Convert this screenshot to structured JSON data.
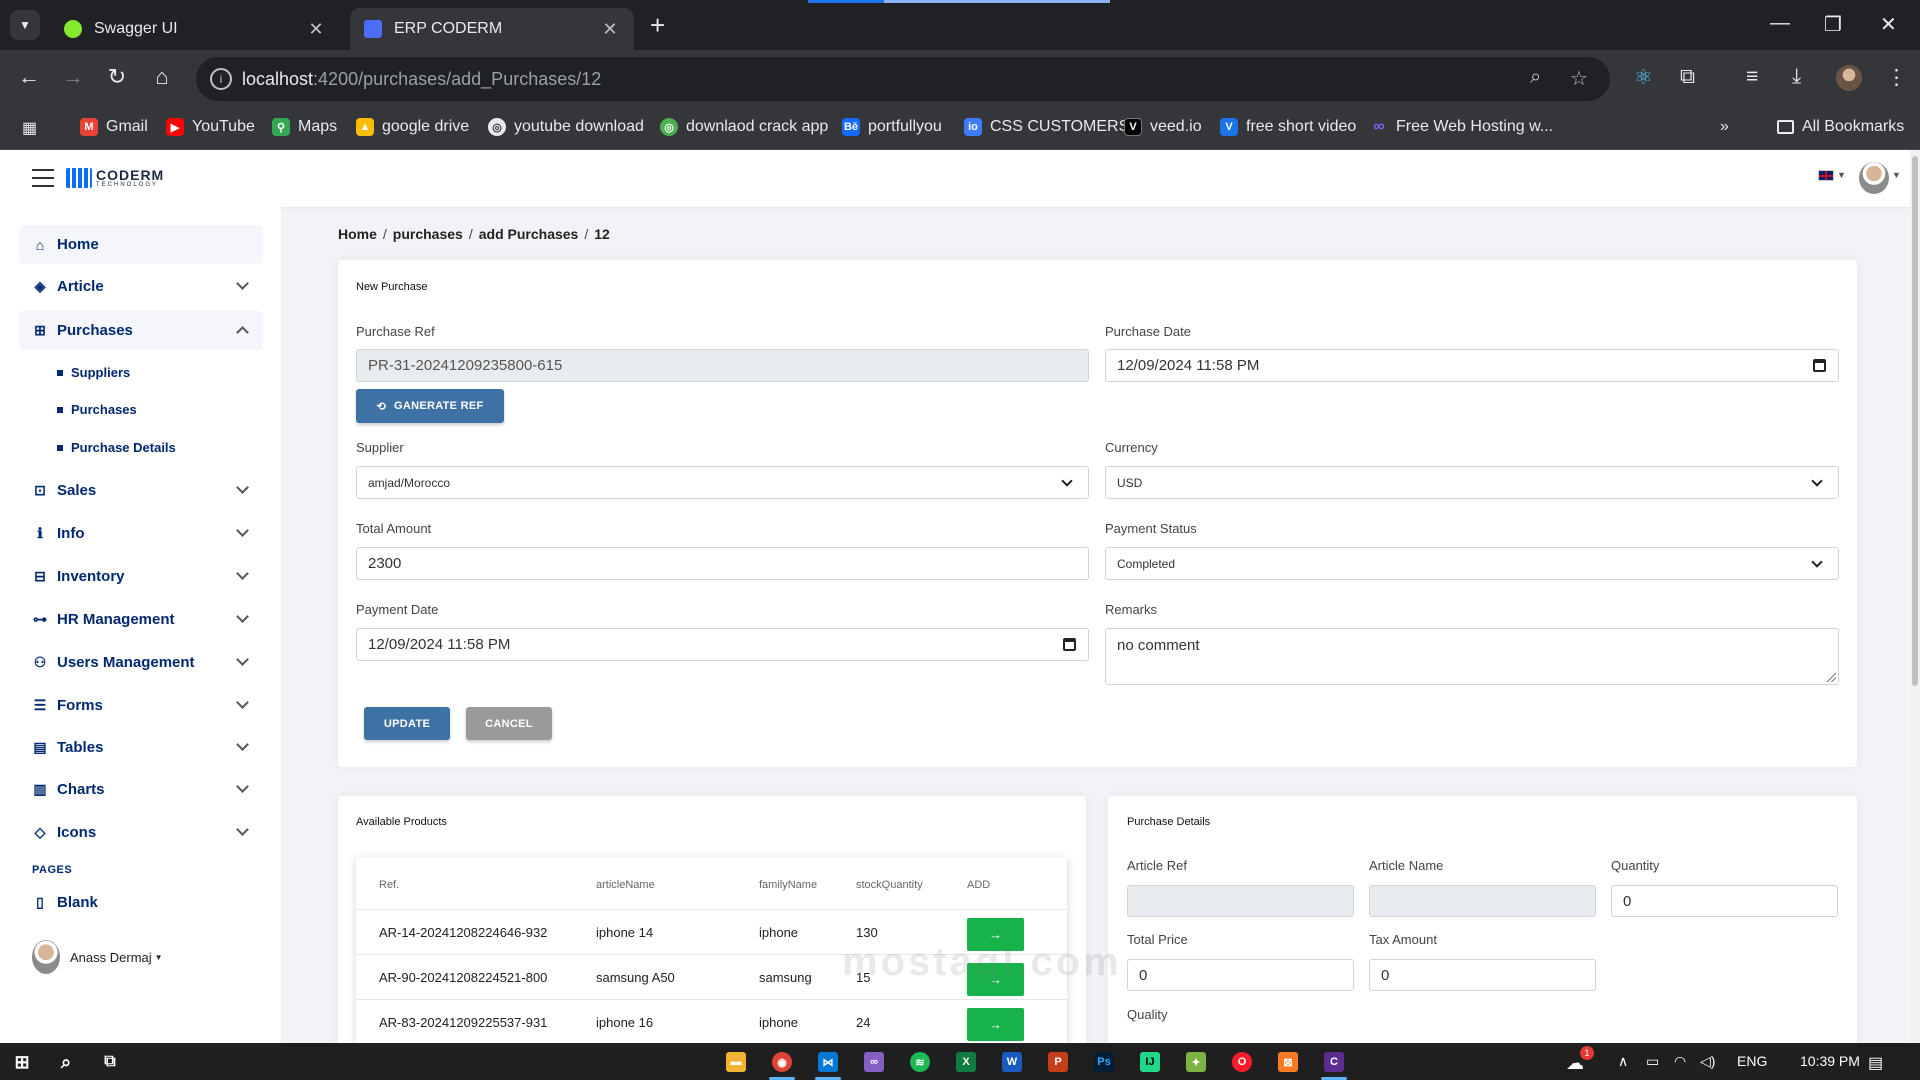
{
  "browser": {
    "tabs": [
      {
        "title": "Swagger UI",
        "favicon_color": "#85ea2d",
        "active": false
      },
      {
        "title": "ERP CODERM",
        "favicon_color": "#4c6ef5",
        "active": true
      }
    ],
    "load_progress": 0.25,
    "url_host": "localhost",
    "url_path": ":4200/purchases/add_Purchases/12",
    "bookmarks": [
      {
        "label": "Gmail",
        "icon": "gmail-icon",
        "color": "#ea4335"
      },
      {
        "label": "YouTube",
        "icon": "youtube-icon",
        "color": "#ff0000"
      },
      {
        "label": "Maps",
        "icon": "maps-icon",
        "color": "#34a853"
      },
      {
        "label": "google drive",
        "icon": "drive-icon",
        "color": "#fbbc04"
      },
      {
        "label": "youtube download",
        "icon": "globe-icon",
        "color": "#9aa0a6"
      },
      {
        "label": "downlaod crack app",
        "icon": "globe-icon",
        "color": "#4caf50"
      },
      {
        "label": "portfullyou",
        "icon": "behance-icon",
        "color": "#1769ff"
      },
      {
        "label": "CSS CUSTOMERS",
        "icon": "css-icon",
        "color": "#3d7bfd"
      },
      {
        "label": "veed.io",
        "icon": "veed-icon",
        "color": "#000000"
      },
      {
        "label": "free short video",
        "icon": "v-icon",
        "color": "#1a73e8"
      },
      {
        "label": "Free Web Hosting w...",
        "icon": "infinity-icon",
        "color": "#7b61ff"
      }
    ],
    "all_bookmarks": "All Bookmarks"
  },
  "sidebar": {
    "items": [
      {
        "label": "Home",
        "icon": "home-icon",
        "glyph": "⌂",
        "chevron": false
      },
      {
        "label": "Article",
        "icon": "box-icon",
        "glyph": "◈",
        "chevron": true
      },
      {
        "label": "Purchases",
        "icon": "cart-icon",
        "glyph": "⊞",
        "chevron": true,
        "expanded": true
      },
      {
        "label": "Sales",
        "icon": "cart-icon",
        "glyph": "⊡",
        "chevron": true
      },
      {
        "label": "Info",
        "icon": "info-icon",
        "glyph": "ℹ",
        "chevron": true
      },
      {
        "label": "Inventory",
        "icon": "inventory-icon",
        "glyph": "⊟",
        "chevron": true
      },
      {
        "label": "HR Management",
        "icon": "org-icon",
        "glyph": "⊶",
        "chevron": true
      },
      {
        "label": "Users Management",
        "icon": "users-icon",
        "glyph": "⚇",
        "chevron": true
      },
      {
        "label": "Forms",
        "icon": "form-icon",
        "glyph": "☰",
        "chevron": true
      },
      {
        "label": "Tables",
        "icon": "table-icon",
        "glyph": "▤",
        "chevron": true
      },
      {
        "label": "Charts",
        "icon": "chart-icon",
        "glyph": "▥",
        "chevron": true
      },
      {
        "label": "Icons",
        "icon": "gem-icon",
        "glyph": "◇",
        "chevron": true
      }
    ],
    "purchases_sub": [
      "Suppliers",
      "Purchases",
      "Purchase Details"
    ],
    "pages_heading": "PAGES",
    "blank": "Blank",
    "user": "Anass Dermaj"
  },
  "breadcrumb": [
    "Home",
    "purchases",
    "add Purchases",
    "12"
  ],
  "form": {
    "title": "New Purchase",
    "purchase_ref_label": "Purchase Ref",
    "purchase_ref": "PR-31-20241209235800-615",
    "generate_btn": "GANERATE REF",
    "purchase_date_label": "Purchase Date",
    "purchase_date": "12/09/2024 11:58 PM",
    "supplier_label": "Supplier",
    "supplier": "amjad/Morocco",
    "currency_label": "Currency",
    "currency": "USD",
    "total_label": "Total Amount",
    "total": "2300",
    "payment_status_label": "Payment Status",
    "payment_status": "Completed",
    "payment_date_label": "Payment Date",
    "payment_date": "12/09/2024 11:58 PM",
    "remarks_label": "Remarks",
    "remarks": "no comment",
    "update_btn": "UPDATE",
    "cancel_btn": "CANCEL"
  },
  "products": {
    "title": "Available Products",
    "columns": [
      "Ref.",
      "articleName",
      "familyName",
      "stockQuantity",
      "ADD"
    ],
    "rows": [
      {
        "ref": "AR-14-20241208224646-932",
        "name": "iphone 14",
        "family": "iphone",
        "stock": "130"
      },
      {
        "ref": "AR-90-20241208224521-800",
        "name": "samsung A50",
        "family": "samsung",
        "stock": "15"
      },
      {
        "ref": "AR-83-20241209225537-931",
        "name": "iphone 16",
        "family": "iphone",
        "stock": "24"
      }
    ],
    "add_glyph": "→"
  },
  "details": {
    "title": "Purchase Details",
    "article_ref_label": "Article Ref",
    "article_ref": "",
    "article_name_label": "Article Name",
    "article_name": "",
    "quantity_label": "Quantity",
    "quantity": "0",
    "total_price_label": "Total Price",
    "total_price": "0",
    "tax_label": "Tax Amount",
    "tax": "0",
    "quality_label": "Quality"
  },
  "watermark": "mostaql.com",
  "taskbar": {
    "lang": "ENG",
    "time": "10:39 PM",
    "notif_count": "1"
  }
}
